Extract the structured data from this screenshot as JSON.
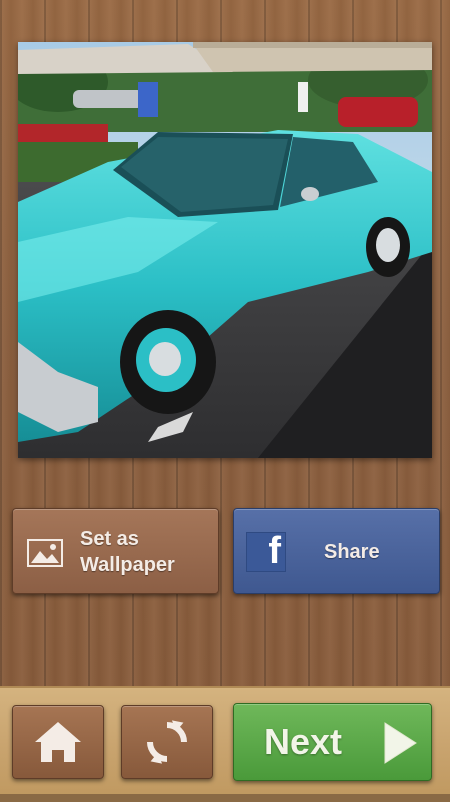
{
  "photo": {
    "description_icon": "classic-car-photo"
  },
  "actions": {
    "wallpaper_label_line1": "Set as",
    "wallpaper_label_line2": "Wallpaper",
    "wallpaper_icon": "image-icon",
    "share_label": "Share",
    "share_icon": "facebook-icon"
  },
  "bottom_bar": {
    "home_icon": "home-icon",
    "reload_icon": "refresh-icon",
    "next_label": "Next",
    "next_icon": "play-arrow-icon"
  },
  "colors": {
    "share_blue": "#4a62a0",
    "next_green": "#5aa845",
    "wood_brown": "#8e6140"
  }
}
